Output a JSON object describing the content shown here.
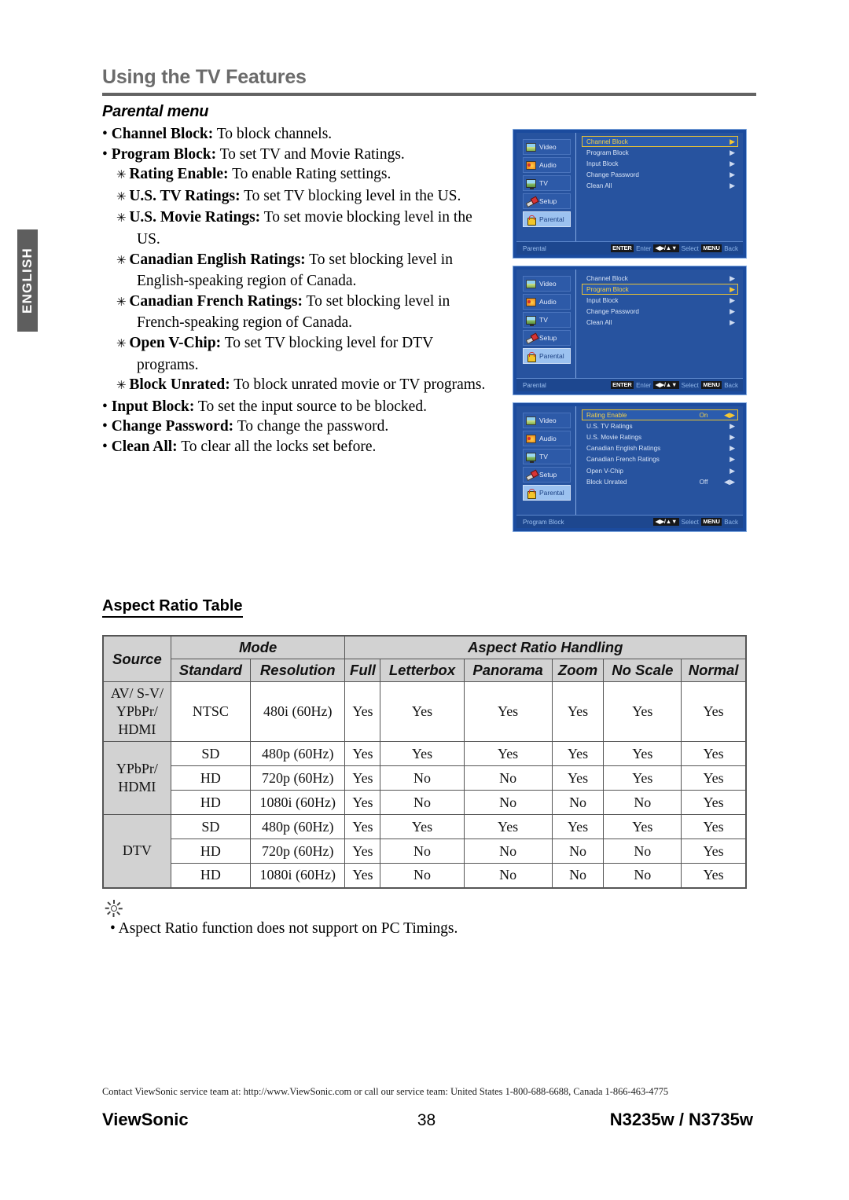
{
  "language_tab": "ENGLISH",
  "header": {
    "title": "Using the TV Features",
    "subtitle": "Parental menu"
  },
  "bullets": [
    {
      "level": 1,
      "term": "Channel Block:",
      "desc": "To block channels."
    },
    {
      "level": 1,
      "term": "Program Block:",
      "desc": "To set TV and Movie Ratings."
    },
    {
      "level": 2,
      "term": "Rating Enable:",
      "desc": "To enable Rating settings."
    },
    {
      "level": 2,
      "term": "U.S. TV Ratings:",
      "desc": "To set TV blocking level in the US."
    },
    {
      "level": 2,
      "term": "U.S. Movie Ratings:",
      "desc": "To set movie blocking level in the US."
    },
    {
      "level": 2,
      "term": "Canadian English Ratings:",
      "desc": "To set blocking level in English-speaking region of Canada."
    },
    {
      "level": 2,
      "term": "Canadian French Ratings:",
      "desc": "To set blocking level in French-speaking region of Canada."
    },
    {
      "level": 2,
      "term": "Open V-Chip:",
      "desc": "To set TV blocking level for DTV programs."
    },
    {
      "level": 2,
      "term": "Block Unrated:",
      "desc": "To block unrated movie or TV programs."
    },
    {
      "level": 1,
      "term": "Input Block:",
      "desc": "To set the input source to be blocked."
    },
    {
      "level": 1,
      "term": "Change Password:",
      "desc": "To change the password."
    },
    {
      "level": 1,
      "term": "Clean All:",
      "desc": "To clear all the locks set before."
    }
  ],
  "osd": {
    "sidebar": [
      {
        "label": "Video",
        "icon": "video-icon",
        "active": false
      },
      {
        "label": "Audio",
        "icon": "audio-icon",
        "active": false
      },
      {
        "label": "TV",
        "icon": "tv-icon",
        "active": false
      },
      {
        "label": "Setup",
        "icon": "setup-icon",
        "active": false
      },
      {
        "label": "Parental",
        "icon": "parental-icon",
        "active": true
      }
    ],
    "arrow_right": "▶",
    "arrow_lr": "◀▶",
    "highlight_color": "#e8c233",
    "panels": [
      {
        "name": "parental-menu-panel",
        "rows": [
          {
            "label": "Channel Block",
            "value": "",
            "selected": true,
            "control": "arrow_right"
          },
          {
            "label": "Program Block",
            "value": "",
            "selected": false,
            "control": "arrow_right"
          },
          {
            "label": "Input Block",
            "value": "",
            "selected": false,
            "control": "arrow_right"
          },
          {
            "label": "Change Password",
            "value": "",
            "selected": false,
            "control": "arrow_right"
          },
          {
            "label": "Clean All",
            "value": "",
            "selected": false,
            "control": "arrow_right"
          }
        ],
        "footer": {
          "title": "Parental",
          "hints": [
            {
              "key": "ENTER",
              "text": "Enter"
            },
            {
              "key": "◀▶/▲▼",
              "text": "Select"
            },
            {
              "key": "MENU",
              "text": "Back"
            }
          ]
        }
      },
      {
        "name": "parental-menu-program-block-selected-panel",
        "rows": [
          {
            "label": "Channel Block",
            "value": "",
            "selected": false,
            "control": "arrow_right"
          },
          {
            "label": "Program Block",
            "value": "",
            "selected": true,
            "control": "arrow_right"
          },
          {
            "label": "Input Block",
            "value": "",
            "selected": false,
            "control": "arrow_right"
          },
          {
            "label": "Change Password",
            "value": "",
            "selected": false,
            "control": "arrow_right"
          },
          {
            "label": "Clean All",
            "value": "",
            "selected": false,
            "control": "arrow_right"
          }
        ],
        "footer": {
          "title": "Parental",
          "hints": [
            {
              "key": "ENTER",
              "text": "Enter"
            },
            {
              "key": "◀▶/▲▼",
              "text": "Select"
            },
            {
              "key": "MENU",
              "text": "Back"
            }
          ]
        }
      },
      {
        "name": "program-block-panel",
        "rows": [
          {
            "label": "Rating Enable",
            "value": "On",
            "selected": true,
            "control": "arrow_lr"
          },
          {
            "label": "U.S. TV Ratings",
            "value": "",
            "selected": false,
            "control": "arrow_right"
          },
          {
            "label": "U.S. Movie Ratings",
            "value": "",
            "selected": false,
            "control": "arrow_right"
          },
          {
            "label": "Canadian English Ratings",
            "value": "",
            "selected": false,
            "control": "arrow_right"
          },
          {
            "label": "Canadian French Ratings",
            "value": "",
            "selected": false,
            "control": "arrow_right"
          },
          {
            "label": "Open V-Chip",
            "value": "",
            "selected": false,
            "control": "arrow_right"
          },
          {
            "label": "Block Unrated",
            "value": "Off",
            "selected": false,
            "control": "arrow_lr"
          }
        ],
        "footer": {
          "title": "Program Block",
          "hints": [
            {
              "key": "◀▶/▲▼",
              "text": "Select"
            },
            {
              "key": "MENU",
              "text": "Back"
            }
          ]
        }
      }
    ]
  },
  "aspect_table": {
    "heading": "Aspect Ratio Table",
    "group_headers": {
      "source": "Source",
      "mode": "Mode",
      "handling": "Aspect Ratio Handling"
    },
    "columns": [
      "Standard",
      "Resolution",
      "Full",
      "Letterbox",
      "Panorama",
      "Zoom",
      "No Scale",
      "Normal"
    ],
    "rows": [
      {
        "source": "AV/ S-V/\nYPbPr/\nHDMI",
        "source_rowspan": 1,
        "tall": true,
        "cells": [
          "NTSC",
          "480i (60Hz)",
          "Yes",
          "Yes",
          "Yes",
          "Yes",
          "Yes",
          "Yes"
        ]
      },
      {
        "source": "YPbPr/\nHDMI",
        "source_rowspan": 3,
        "tall": false,
        "cells": [
          "SD",
          "480p (60Hz)",
          "Yes",
          "Yes",
          "Yes",
          "Yes",
          "Yes",
          "Yes"
        ]
      },
      {
        "source": null,
        "tall": false,
        "cells": [
          "HD",
          "720p (60Hz)",
          "Yes",
          "No",
          "No",
          "Yes",
          "Yes",
          "Yes"
        ]
      },
      {
        "source": null,
        "tall": false,
        "cells": [
          "HD",
          "1080i (60Hz)",
          "Yes",
          "No",
          "No",
          "No",
          "No",
          "Yes"
        ]
      },
      {
        "source": "DTV",
        "source_rowspan": 3,
        "tall": false,
        "cells": [
          "SD",
          "480p (60Hz)",
          "Yes",
          "Yes",
          "Yes",
          "Yes",
          "Yes",
          "Yes"
        ]
      },
      {
        "source": null,
        "tall": false,
        "cells": [
          "HD",
          "720p (60Hz)",
          "Yes",
          "No",
          "No",
          "No",
          "No",
          "Yes"
        ]
      },
      {
        "source": null,
        "tall": false,
        "cells": [
          "HD",
          "1080i (60Hz)",
          "Yes",
          "No",
          "No",
          "No",
          "No",
          "Yes"
        ]
      }
    ]
  },
  "note": {
    "icon": "sun-tip-icon",
    "text": "• Aspect Ratio function does not support on PC Timings."
  },
  "footer": {
    "contact": "Contact ViewSonic service team at: http://www.ViewSonic.com or call our service team: United States 1-800-688-6688, Canada 1-866-463-4775",
    "brand": "ViewSonic",
    "page_number": "38",
    "model": "N3235w / N3735w"
  }
}
